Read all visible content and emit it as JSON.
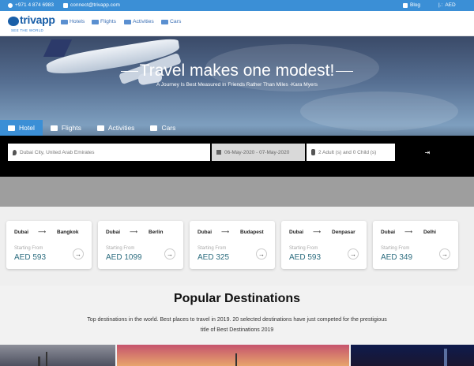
{
  "topbar": {
    "phone": "+971 4 874 6983",
    "email": "connect@trivapp.com",
    "blog": "Blog",
    "currency": "AED"
  },
  "brand": {
    "name": "trivapp",
    "tagline": "SEE THE WORLD"
  },
  "nav": {
    "items": [
      {
        "label": "Hotels",
        "icon": "bed-icon"
      },
      {
        "label": "Flights",
        "icon": "plane-icon"
      },
      {
        "label": "Activities",
        "icon": "binoculars-icon"
      },
      {
        "label": "Cars",
        "icon": "car-icon"
      }
    ]
  },
  "hero": {
    "title": "Travel makes one modest!",
    "subtitle": "A Journey Is Best Measured In Friends Rather Than Miles -Kara Myers"
  },
  "tabs": [
    {
      "label": "Hotel",
      "icon": "bed-icon",
      "active": true
    },
    {
      "label": "Flights",
      "icon": "plane-icon",
      "active": false
    },
    {
      "label": "Activities",
      "icon": "binoculars-icon",
      "active": false
    },
    {
      "label": "Cars",
      "icon": "car-icon",
      "active": false
    }
  ],
  "search": {
    "destination": "Dubai City, United Arab Emirates",
    "dates": "06-May-2020 - 07-May-2020",
    "guests": "2 Adult (s) and 0 Child (s)",
    "button_icon": "search-icon"
  },
  "routes": [
    {
      "from": "Dubai",
      "to": "Bangkok",
      "label": "Starting From",
      "price": "AED 593"
    },
    {
      "from": "Dubai",
      "to": "Berlin",
      "label": "Starting From",
      "price": "AED 1099"
    },
    {
      "from": "Dubai",
      "to": "Budapest",
      "label": "Starting From",
      "price": "AED 325"
    },
    {
      "from": "Dubai",
      "to": "Denpasar",
      "label": "Starting From",
      "price": "AED 593"
    },
    {
      "from": "Dubai",
      "to": "Delhi",
      "label": "Starting From",
      "price": "AED 349"
    }
  ],
  "popular": {
    "title": "Popular Destinations",
    "description": "Top destinations in the world. Best places to travel in 2019. 20 selected destinations have just competed for the prestigious title of Best Destinations 2019"
  },
  "colors": {
    "primary": "#3b8fd6",
    "price": "#2e6e80"
  }
}
